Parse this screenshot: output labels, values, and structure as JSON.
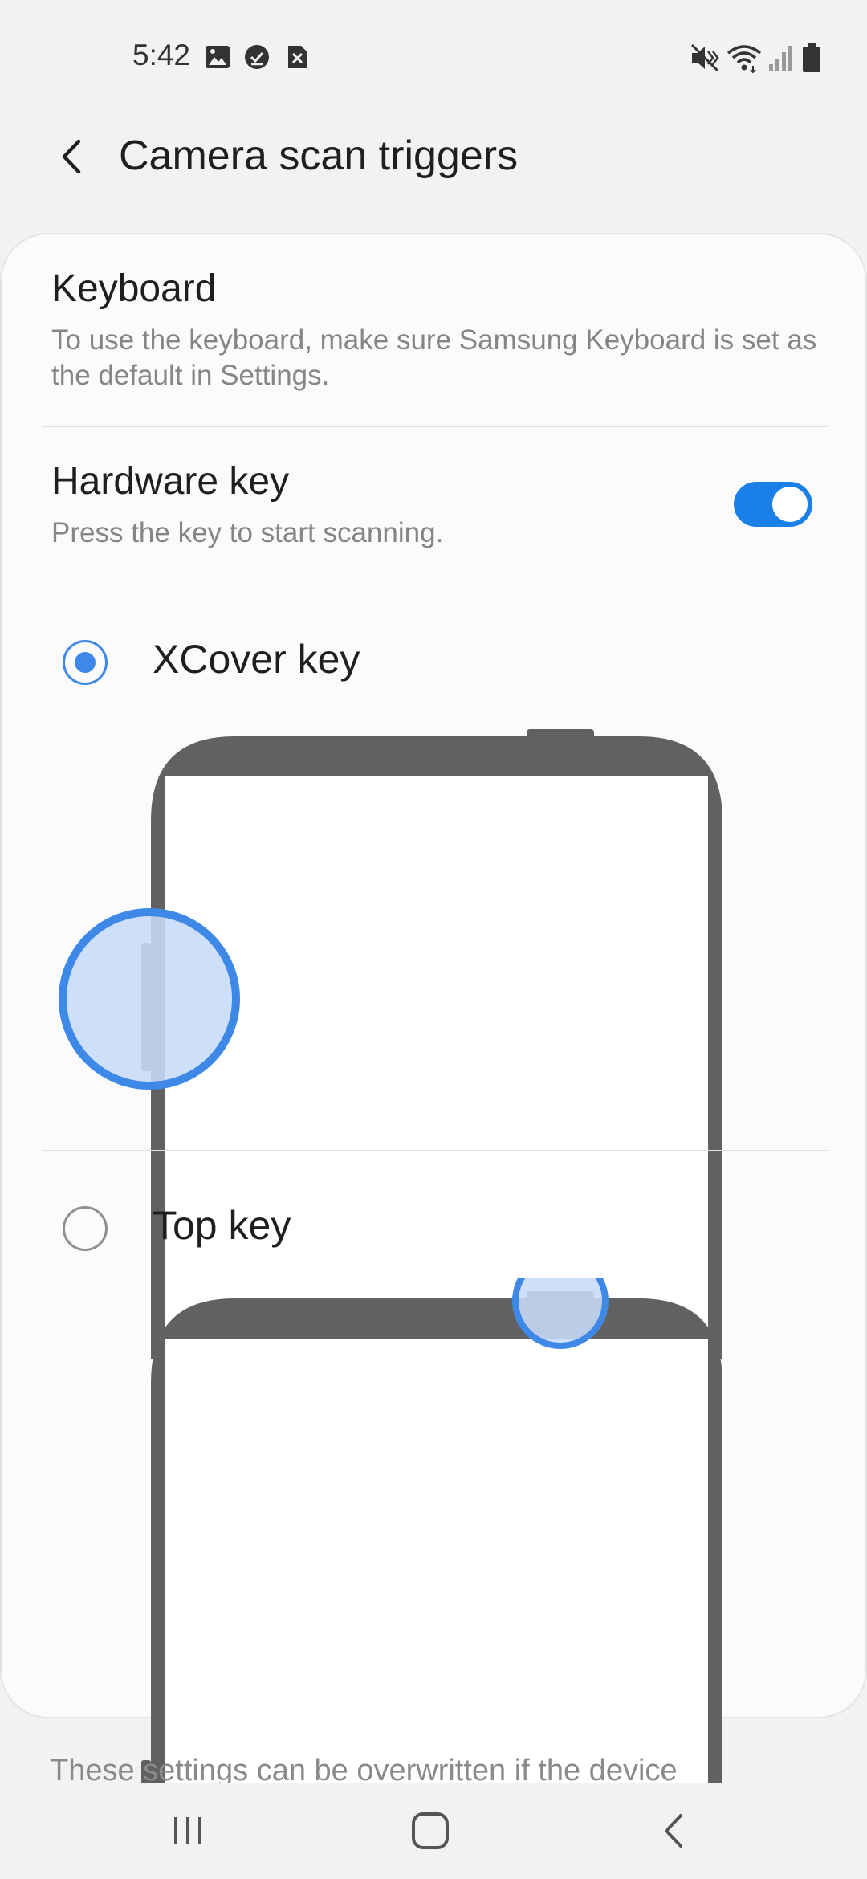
{
  "status_bar": {
    "time": "5:42",
    "left_icons": [
      "image-icon",
      "check-circle-icon",
      "sim-error-icon"
    ],
    "right_icons": [
      "mute-icon",
      "wifi-icon",
      "signal-icon",
      "battery-icon"
    ]
  },
  "app_bar": {
    "back_icon": "chevron-left-icon",
    "title": "Camera scan triggers"
  },
  "keyboard": {
    "title": "Keyboard",
    "description": "To use the keyboard, make sure Samsung Keyboard is set as the default in Settings."
  },
  "hardware_key": {
    "title": "Hardware key",
    "description": "Press the key to start scanning.",
    "enabled": true
  },
  "options": [
    {
      "label": "XCover key",
      "selected": true
    },
    {
      "label": "Top key",
      "selected": false
    }
  ],
  "footer_note": "These settings can be overwritten if the device",
  "nav_bar": {
    "recents_icon": "recents-icon",
    "home_icon": "home-icon",
    "back_icon": "back-icon"
  },
  "colors": {
    "accent": "#3e89e8",
    "toggle_on": "#1a7fe6",
    "phone_frame": "#616161",
    "highlight_fill": "#c7dcf8",
    "background": "#f2f2f2",
    "card": "#fbfbfb"
  }
}
